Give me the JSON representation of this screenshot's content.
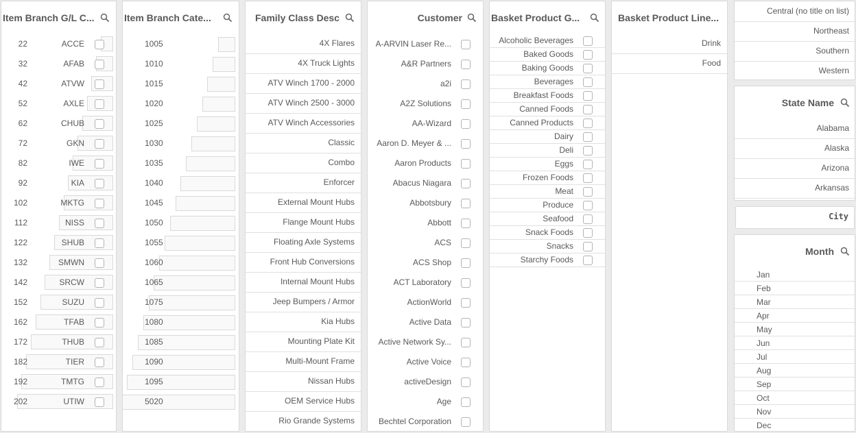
{
  "gl_panel": {
    "title": "Item Branch G/L C...",
    "rows": [
      {
        "num": "22",
        "code": "ACCE"
      },
      {
        "num": "32",
        "code": "AFAB"
      },
      {
        "num": "42",
        "code": "ATVW"
      },
      {
        "num": "52",
        "code": "AXLE"
      },
      {
        "num": "62",
        "code": "CHUB"
      },
      {
        "num": "72",
        "code": "GKN"
      },
      {
        "num": "82",
        "code": "IWE"
      },
      {
        "num": "92",
        "code": "KIA"
      },
      {
        "num": "102",
        "code": "MKTG"
      },
      {
        "num": "112",
        "code": "NISS"
      },
      {
        "num": "122",
        "code": "SHUB"
      },
      {
        "num": "132",
        "code": "SMWN"
      },
      {
        "num": "142",
        "code": "SRCW"
      },
      {
        "num": "152",
        "code": "SUZU"
      },
      {
        "num": "162",
        "code": "TFAB"
      },
      {
        "num": "172",
        "code": "THUB"
      },
      {
        "num": "182",
        "code": "TIER"
      },
      {
        "num": "192",
        "code": "TMTG"
      },
      {
        "num": "202",
        "code": "UTIW"
      }
    ]
  },
  "category_panel": {
    "title": "Item Branch Cate...",
    "values": [
      "1005",
      "1010",
      "1015",
      "1020",
      "1025",
      "1030",
      "1035",
      "1040",
      "1045",
      "1050",
      "1055",
      "1060",
      "1065",
      "1075",
      "1080",
      "1085",
      "1090",
      "1095",
      "5020"
    ]
  },
  "family_panel": {
    "title": "Family Class Desc",
    "items": [
      "4X Flares",
      "4X Truck Lights",
      "ATV Winch 1700 - 2000",
      "ATV Winch 2500 - 3000",
      "ATV Winch Accessories",
      "Classic",
      "Combo",
      "Enforcer",
      "External Mount Hubs",
      "Flange Mount Hubs",
      "Floating Axle Systems",
      "Front Hub Conversions",
      "Internal Mount Hubs",
      "Jeep Bumpers / Armor",
      "Kia Hubs",
      "Mounting Plate Kit",
      "Multi-Mount Frame",
      "Nissan Hubs",
      "OEM Service Hubs",
      "Rio Grande Systems"
    ]
  },
  "customer_panel": {
    "title": "Customer",
    "items": [
      "A-ARVIN Laser Re...",
      "A&R Partners",
      "a2i",
      "A2Z Solutions",
      "AA-Wizard",
      "Aaron D. Meyer & ...",
      "Aaron Products",
      "Abacus Niagara",
      "Abbotsbury",
      "Abbott",
      "ACS",
      "ACS  Shop",
      "ACT Laboratory",
      "ActionWorld",
      "Active Data",
      "Active Network Sy...",
      "Active Voice",
      "activeDesign",
      "Age",
      "Bechtel Corporation"
    ]
  },
  "basket_group_panel": {
    "title": "Basket Product G...",
    "items": [
      "Alcoholic Beverages",
      "Baked Goods",
      "Baking Goods",
      "Beverages",
      "Breakfast Foods",
      "Canned Foods",
      "Canned Products",
      "Dairy",
      "Deli",
      "Eggs",
      "Frozen Foods",
      "Meat",
      "Produce",
      "Seafood",
      "Snack Foods",
      "Snacks",
      "Starchy Foods"
    ]
  },
  "basket_line_panel": {
    "title": "Basket Product Line...",
    "items": [
      "Drink",
      "Food"
    ]
  },
  "region_panel": {
    "items": [
      "Central (no title on list)",
      "Northeast",
      "Southern",
      "Western"
    ]
  },
  "state_panel": {
    "title": "State Name",
    "items": [
      "Alabama",
      "Alaska",
      "Arizona",
      "Arkansas"
    ]
  },
  "city_panel": {
    "label": "City"
  },
  "month_panel": {
    "title": "Month",
    "items": [
      "Jan",
      "Feb",
      "Mar",
      "Apr",
      "May",
      "Jun",
      "Jul",
      "Aug",
      "Sep",
      "Oct",
      "Nov",
      "Dec"
    ]
  }
}
